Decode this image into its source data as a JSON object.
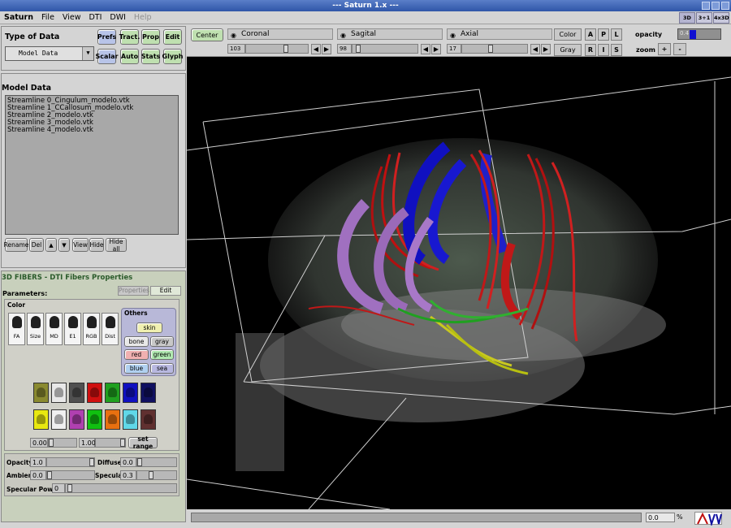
{
  "window": {
    "title": "--- Saturn 1.x ---"
  },
  "menu": [
    {
      "label": "Saturn",
      "bold": true
    },
    {
      "label": "File"
    },
    {
      "label": "View"
    },
    {
      "label": "DTI"
    },
    {
      "label": "DWI"
    },
    {
      "label": "Help",
      "disabled": true
    }
  ],
  "view_tabs": [
    "3D",
    "3+1",
    "4x3D"
  ],
  "left": {
    "type_of_data_label": "Type of Data",
    "data_select": "Model Data",
    "buttons_row1": [
      "Prefs",
      "Tract.",
      "Prop",
      "Edit"
    ],
    "buttons_row2": [
      "Scalar",
      "Auto",
      "Stats",
      "Glyph"
    ],
    "model_data_label": "Model Data",
    "model_items": [
      "Streamline 0_Cingulum_modelo.vtk",
      "Streamline 1_CCallosum_modelo.vtk",
      "Streamline 2_modelo.vtk",
      "Streamline 3_modelo.vtk",
      "Streamline 4_modelo.vtk"
    ],
    "list_buttons": [
      "Rename",
      "Del",
      "▲",
      "▼",
      "View",
      "Hide",
      "Hide all"
    ]
  },
  "props": {
    "header": "3D FIBERS - DTI Fibers Properties",
    "parameters_label": "Parameters:",
    "tab_properties": "Properties",
    "tab_edit": "Edit",
    "color_label": "Color",
    "color_modes": [
      "FA",
      "Size",
      "MD",
      "E1",
      "RGB",
      "Dist"
    ],
    "others_label": "Others",
    "others": {
      "skin": "skin",
      "bone": "bone",
      "gray": "gray",
      "red": "red",
      "green": "green",
      "blue": "blue",
      "sea": "sea"
    },
    "palette_row1": [
      "#8a8a30",
      "#e8e8e8",
      "#505050",
      "#d01010",
      "#20a020",
      "#1010c0",
      "#101060"
    ],
    "palette_row2": [
      "#e8e810",
      "#f0f0f0",
      "#b040b0",
      "#10c010",
      "#e87010",
      "#60d8e8",
      "#603030"
    ],
    "range_min": "0.00",
    "range_max": "1.00",
    "set_range": "set range",
    "opacity_label": "Opacity",
    "opacity_value": "1.0",
    "ambient_label": "Ambient",
    "ambient_value": "0.0",
    "diffuse_label": "Diffuse",
    "diffuse_value": "0.0",
    "specular_label": "Specular",
    "specular_value": "0.3",
    "specular_power_label": "Specular Power",
    "specular_power_value": "0"
  },
  "toolbar": {
    "center": "Center",
    "coronal": "Coronal",
    "sagital": "Sagital",
    "axial": "Axial",
    "coronal_value": "103",
    "sagital_value": "98",
    "axial_value": "17",
    "color": "Color",
    "gray": "Gray",
    "orient_row1": [
      "A",
      "P",
      "L"
    ],
    "orient_row2": [
      "R",
      "I",
      "S"
    ],
    "opacity_label": "opacity",
    "opacity_value": "0.4",
    "zoom_label": "zoom",
    "zoom_in": "+",
    "zoom_out": "-"
  },
  "status": {
    "progress_value": "0.0",
    "progress_unit": "%"
  }
}
